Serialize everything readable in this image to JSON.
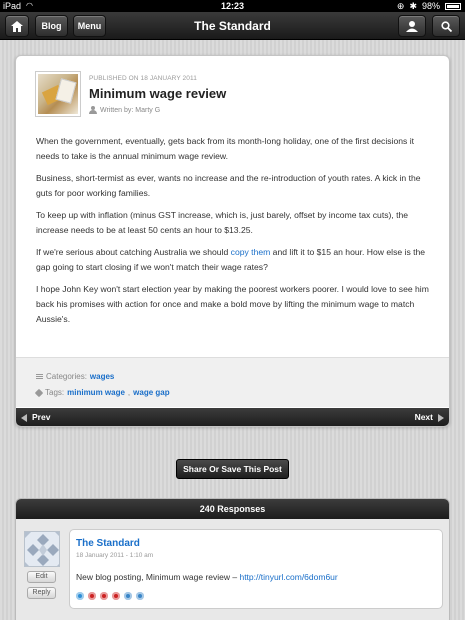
{
  "status": {
    "carrier": "iPad",
    "time": "12:23",
    "battery": "98%"
  },
  "nav": {
    "home_icon": "home-icon",
    "blog_label": "Blog",
    "menu_label": "Menu",
    "title": "The Standard",
    "user_icon": "user-icon",
    "search_icon": "search-icon"
  },
  "post": {
    "published": "PUBLISHED ON 18 JANUARY 2011",
    "title": "Minimum wage review",
    "byline": "Written by: Marty G",
    "paragraphs": [
      "When the government, eventually, gets back from its month-long holiday, one of the first decisions it needs to take is the annual minimum wage review.",
      "Business, short-termist as ever, wants no increase and the re-introduction of youth rates. A kick in the guts for poor working families.",
      "To keep up with inflation (minus GST increase, which is, just barely, offset by income tax cuts), the increase needs to be at least 50 cents an hour to $13.25.",
      "I hope John Key won't start election year by making the poorest workers poorer. I would love to see him back his promises with action for once and make a bold move by lifting the minimum wage to match Aussie's."
    ],
    "p4_before": "If we're serious about catching Australia we should ",
    "p4_link": "copy them",
    "p4_after": " and lift it to $15 an hour. How else is the gap going to start closing if we won't match their wage rates?",
    "categories_label": "Categories:",
    "category": "wages",
    "tags_label": "Tags:",
    "tag1": "minimum wage",
    "tag_sep": ",",
    "tag2": "wage gap",
    "prev_label": "Prev",
    "next_label": "Next"
  },
  "share_label": "Share Or Save This Post",
  "responses": {
    "header": "240 Responses",
    "edit_label": "Edit",
    "reply_label": "Reply",
    "comment": {
      "author": "The Standard",
      "date": "18 January 2011 - 1:10 am",
      "text_before": "New blog posting, Minimum wage review – ",
      "link": "http://tinyurl.com/6dom6ur"
    },
    "icon_colors": [
      "#2f8fd6",
      "#cc2222",
      "#cc2222",
      "#cc2222",
      "#3a86c8",
      "#3a86c8"
    ]
  }
}
